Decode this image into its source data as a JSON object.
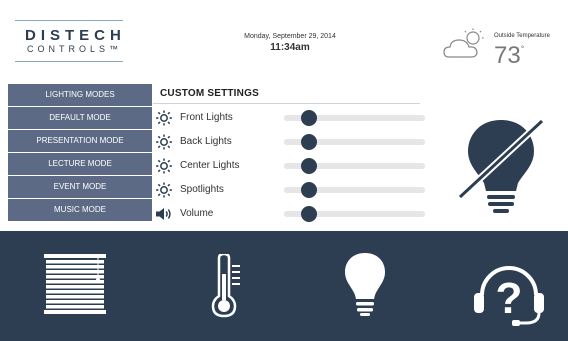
{
  "header": {
    "brand_main": "DISTECH",
    "brand_sub": "CONTROLS™",
    "date": "Monday, September 29, 2014",
    "time": "11:34am",
    "weather_icon": "partly-cloudy-icon",
    "outside_label": "Outside Temperature",
    "outside_temp": "73",
    "outside_unit": "°"
  },
  "sidebar": {
    "items": [
      {
        "label": "LIGHTING MODES"
      },
      {
        "label": "DEFAULT MODE"
      },
      {
        "label": "PRESENTATION MODE"
      },
      {
        "label": "LECTURE MODE"
      },
      {
        "label": "EVENT MODE"
      },
      {
        "label": "MUSIC MODE"
      }
    ]
  },
  "settings": {
    "title": "CUSTOM SETTINGS",
    "rows": [
      {
        "label": "Front Lights",
        "icon": "sun-icon",
        "level": 0.18
      },
      {
        "label": "Back Lights",
        "icon": "sun-icon",
        "level": 0.18
      },
      {
        "label": "Center Lights",
        "icon": "sun-icon",
        "level": 0.18
      },
      {
        "label": "Spotlights",
        "icon": "sun-icon",
        "level": 0.18
      },
      {
        "label": "Volume",
        "icon": "speaker-icon",
        "level": 0.18
      }
    ],
    "status_icon": "light-off-icon"
  },
  "bottom_bar": {
    "items": [
      {
        "icon": "blinds-icon"
      },
      {
        "icon": "thermometer-icon"
      },
      {
        "icon": "light-bulb-icon"
      },
      {
        "icon": "help-headset-icon"
      }
    ]
  },
  "colors": {
    "navy": "#2d3e52",
    "sidebar": "#5c6a85",
    "track": "#e6e6e6"
  }
}
